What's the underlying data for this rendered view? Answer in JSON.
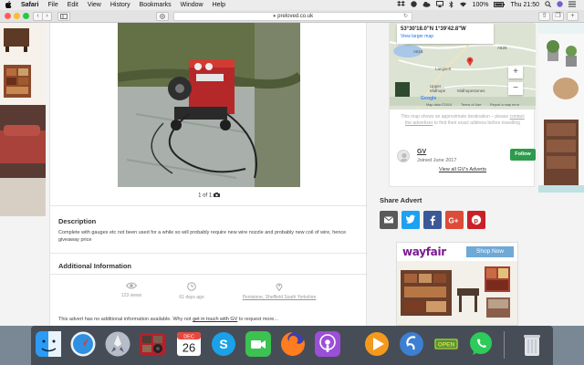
{
  "menubar": {
    "app": "Safari",
    "items": [
      "File",
      "Edit",
      "View",
      "History",
      "Bookmarks",
      "Window",
      "Help"
    ],
    "battery": "100%",
    "clock": "Thu 21:50"
  },
  "toolbar": {
    "url": "preloved.co.uk"
  },
  "listing": {
    "photo_count": "1 of 1",
    "description_heading": "Description",
    "description_text": "Complete with gauges etc not been used for a while so will probably require new wire nozzle and probably new coil of wire, hence giveaway price",
    "info_heading": "Additional Information",
    "views": "123 views",
    "posted": "61 days ago",
    "location": "Penistone, Sheffield South Yorkshire",
    "no_info_before": "This advert has no additional information available. Why not",
    "no_info_link": "get in touch with GV",
    "no_info_after": "to request more..."
  },
  "map": {
    "coordinates": "53°30'18.0\"N 1°39'42.8\"W",
    "larger_map": "View larger map",
    "labels": {
      "langsett": "Langsett",
      "upper_midhope": "Upper Midhope",
      "midhopestones": "Midhopestones",
      "road_a616": "A616",
      "road_a628": "A628",
      "map_data": "Map data ©2019",
      "terms": "Terms of Use",
      "report": "Report a map error",
      "google": "Google"
    },
    "zoom_in": "+",
    "zoom_out": "−",
    "note_before": "This map shows an approximate destination – please",
    "note_link": "contact the advertiser",
    "note_after": "to find their exact address before travelling"
  },
  "seller": {
    "name": "GV",
    "joined": "Joined June 2017",
    "follow": "Follow",
    "view_ads": "View all GV's Adverts"
  },
  "share": {
    "title": "Share Advert",
    "buttons": [
      {
        "name": "email",
        "color": "#5a5a5a"
      },
      {
        "name": "twitter",
        "color": "#1da1f2"
      },
      {
        "name": "facebook",
        "color": "#3b5998"
      },
      {
        "name": "google-plus",
        "color": "#dd4b39"
      },
      {
        "name": "pinterest",
        "color": "#cb2027"
      }
    ]
  },
  "ad": {
    "brand": "wayfair",
    "cta": "Shop Now"
  },
  "dock": {
    "calendar_month": "DEC",
    "calendar_day": "26",
    "badge": "OPEN",
    "apps": [
      "finder",
      "safari",
      "launchpad",
      "photo-booth",
      "calendar",
      "skype",
      "facetime",
      "firefox",
      "podcasts",
      "vlc",
      "simplenote",
      "open-badge-app",
      "whatsapp",
      "trash"
    ]
  },
  "colors": {
    "follow": "#2e9a4c",
    "link": "#1a73e8",
    "wayfair": "#7b1b8f",
    "shop_now": "#6fa9d6"
  }
}
